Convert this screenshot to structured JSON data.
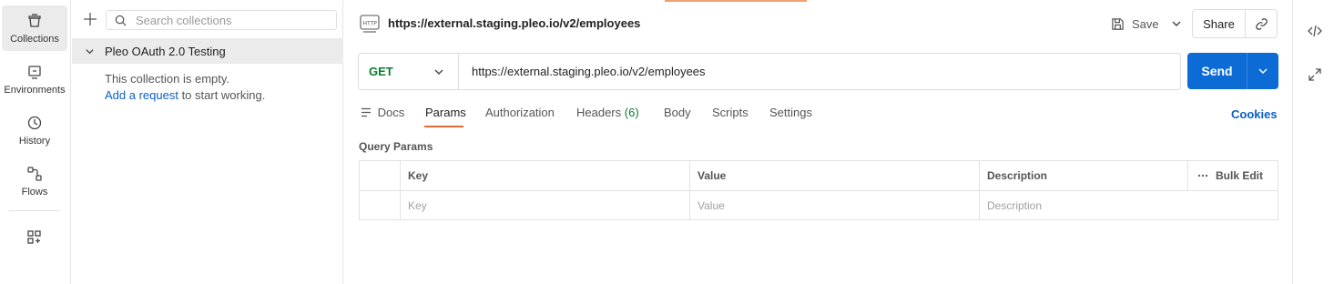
{
  "rail": {
    "items": [
      {
        "label": "Collections",
        "icon": "collections-icon"
      },
      {
        "label": "Environments",
        "icon": "environments-icon"
      },
      {
        "label": "History",
        "icon": "history-icon"
      },
      {
        "label": "Flows",
        "icon": "flows-icon"
      }
    ],
    "apps_icon": "apps-grid-icon"
  },
  "sidebar": {
    "search_placeholder": "Search collections",
    "collection_name": "Pleo OAuth 2.0 Testing",
    "empty_text": "This collection is empty.",
    "add_request_link": "Add a request",
    "add_request_suffix": " to start working."
  },
  "request": {
    "title": "https://external.staging.pleo.io/v2/employees",
    "method": "GET",
    "url": "https://external.staging.pleo.io/v2/employees",
    "save_label": "Save",
    "share_label": "Share",
    "send_label": "Send"
  },
  "tabs": {
    "docs": "Docs",
    "params": "Params",
    "authorization": "Authorization",
    "headers": "Headers",
    "headers_count": "(6)",
    "body": "Body",
    "scripts": "Scripts",
    "settings": "Settings",
    "cookies": "Cookies"
  },
  "params": {
    "title": "Query Params",
    "columns": {
      "key": "Key",
      "value": "Value",
      "description": "Description",
      "bulk_edit": "Bulk Edit"
    },
    "placeholders": {
      "key": "Key",
      "value": "Value",
      "description": "Description"
    }
  },
  "colors": {
    "accent": "#e06a38",
    "send": "#0d6bd6",
    "get_method": "#0a7b2f",
    "link": "#0b5fc7"
  }
}
